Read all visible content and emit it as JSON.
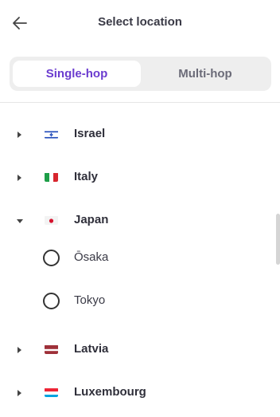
{
  "header": {
    "title": "Select location",
    "back_icon": "arrow-left-icon"
  },
  "tabs": {
    "single_hop": "Single-hop",
    "multi_hop": "Multi-hop",
    "active": "single_hop"
  },
  "colors": {
    "accent": "#6b3ccf",
    "tab_track": "#eeeeee",
    "text": "#2f2f3a"
  },
  "locations": [
    {
      "country": "Israel",
      "flag": "flag-israel-icon",
      "expanded": false
    },
    {
      "country": "Italy",
      "flag": "flag-italy-icon",
      "expanded": false
    },
    {
      "country": "Japan",
      "flag": "flag-japan-icon",
      "expanded": true,
      "cities": [
        "Ōsaka",
        "Tokyo"
      ]
    },
    {
      "country": "Latvia",
      "flag": "flag-latvia-icon",
      "expanded": false
    },
    {
      "country": "Luxembourg",
      "flag": "flag-luxembourg-icon",
      "expanded": false
    }
  ]
}
